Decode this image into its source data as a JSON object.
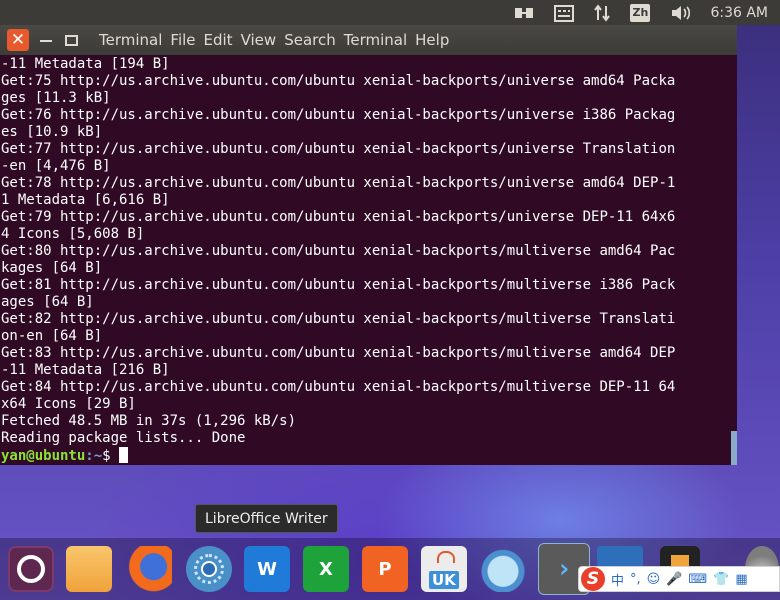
{
  "top_panel": {
    "input_method": "Zh",
    "clock": "6:36 AM",
    "icons": [
      "network-icon",
      "keyboard-icon",
      "transfer-arrows-icon",
      "input-method-icon",
      "volume-icon"
    ]
  },
  "terminal": {
    "menus": [
      "Terminal",
      "File",
      "Edit",
      "View",
      "Search",
      "Terminal",
      "Help"
    ],
    "lines": [
      "-11 Metadata [194 B]",
      "Get:75 http://us.archive.ubuntu.com/ubuntu xenial-backports/universe amd64 Packa",
      "ges [11.3 kB]",
      "Get:76 http://us.archive.ubuntu.com/ubuntu xenial-backports/universe i386 Packag",
      "es [10.9 kB]",
      "Get:77 http://us.archive.ubuntu.com/ubuntu xenial-backports/universe Translation",
      "-en [4,476 B]",
      "Get:78 http://us.archive.ubuntu.com/ubuntu xenial-backports/universe amd64 DEP-1",
      "1 Metadata [6,616 B]",
      "Get:79 http://us.archive.ubuntu.com/ubuntu xenial-backports/universe DEP-11 64x6",
      "4 Icons [5,608 B]",
      "Get:80 http://us.archive.ubuntu.com/ubuntu xenial-backports/multiverse amd64 Pac",
      "kages [64 B]",
      "Get:81 http://us.archive.ubuntu.com/ubuntu xenial-backports/multiverse i386 Pack",
      "ages [64 B]",
      "Get:82 http://us.archive.ubuntu.com/ubuntu xenial-backports/multiverse Translati",
      "on-en [64 B]",
      "Get:83 http://us.archive.ubuntu.com/ubuntu xenial-backports/multiverse amd64 DEP",
      "-11 Metadata [216 B]",
      "Get:84 http://us.archive.ubuntu.com/ubuntu xenial-backports/multiverse DEP-11 64",
      "x64 Icons [29 B]",
      "Fetched 48.5 MB in 37s (1,296 kB/s)",
      "Reading package lists... Done"
    ],
    "prompt_user": "yan@ubuntu",
    "prompt_path": ":~",
    "prompt_symbol": "$"
  },
  "tooltip": "LibreOffice Writer",
  "dock": {
    "writer_letter": "W",
    "calc_letter": "X",
    "impress_letter": "P",
    "software_center_label": "UK"
  },
  "ime": {
    "logo": "S",
    "lang": "中",
    "punct": "°,",
    "emoji": "☺",
    "mic": "🎤",
    "keyboard": "⌨",
    "skin": "👕",
    "tools": "▦"
  }
}
